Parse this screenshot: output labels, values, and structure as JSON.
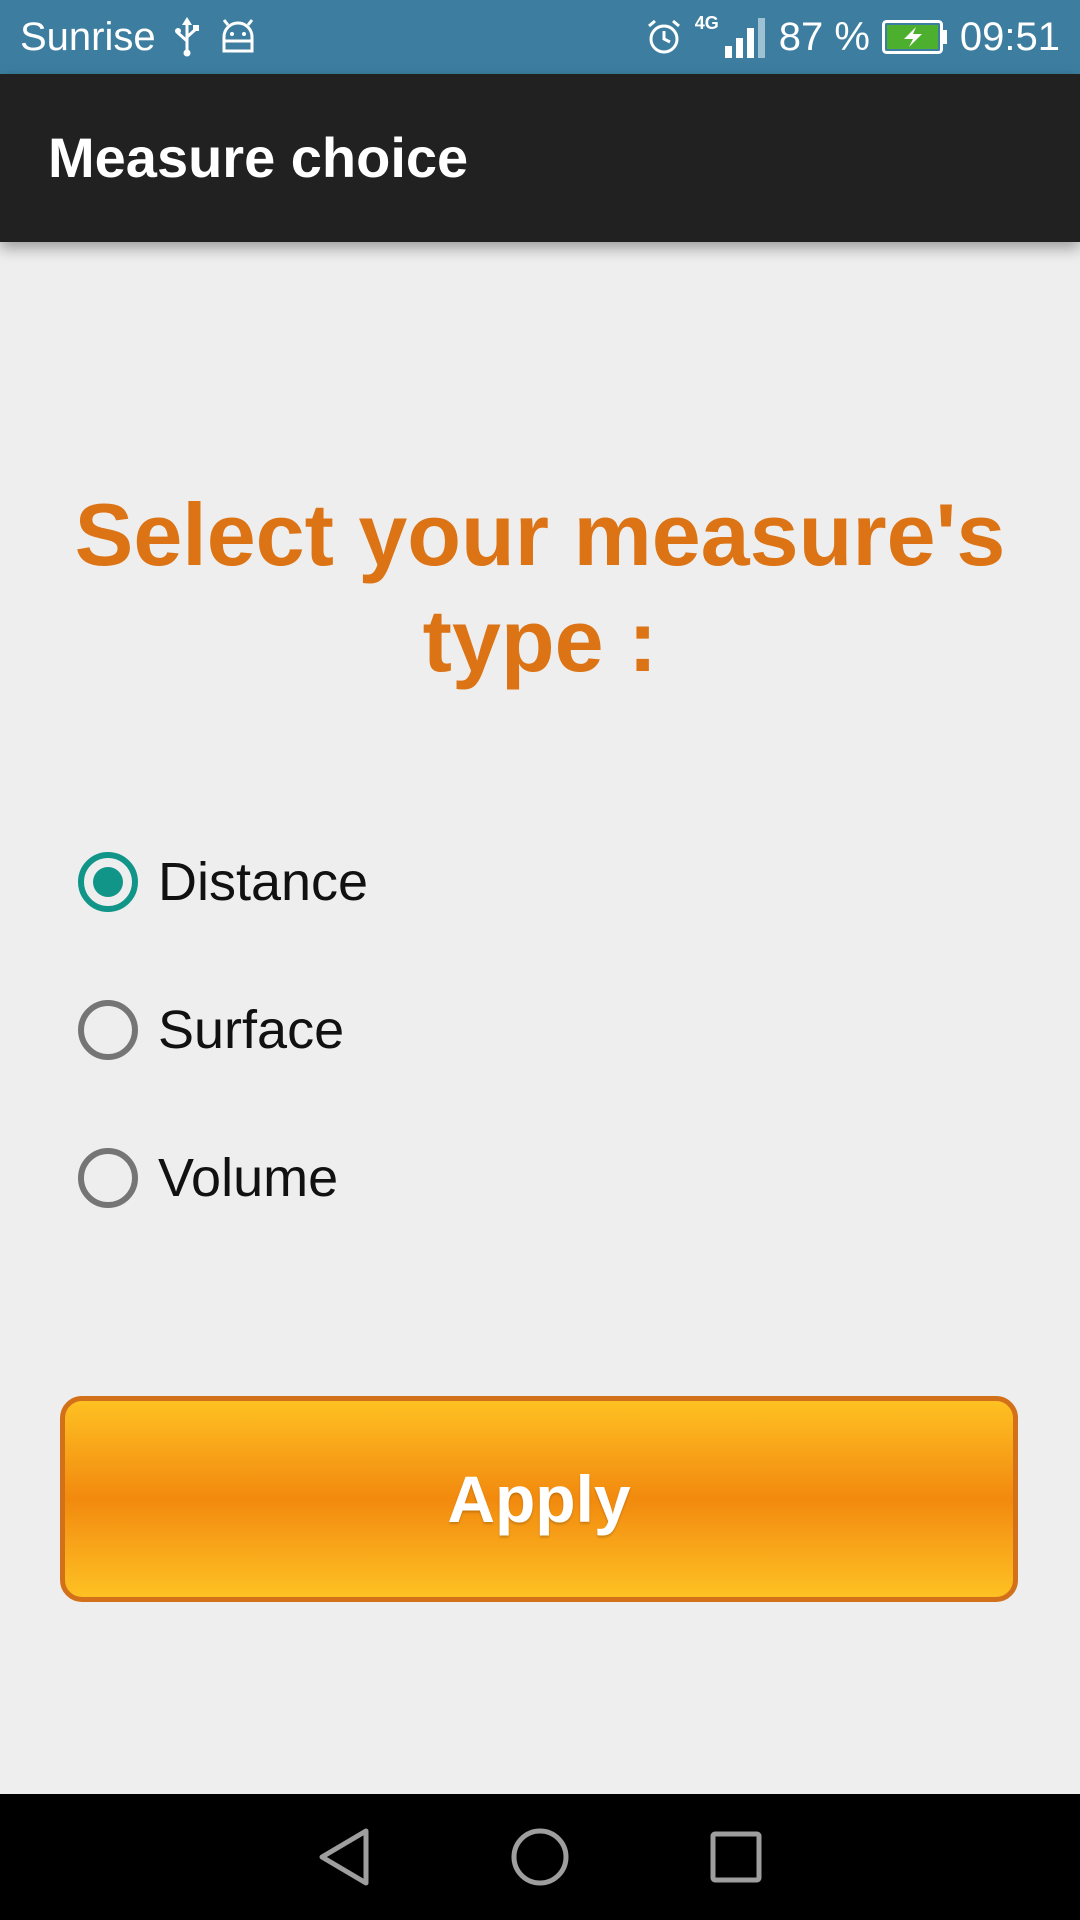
{
  "status_bar": {
    "carrier": "Sunrise",
    "network": "4G",
    "battery": "87 %",
    "time": "09:51",
    "icons": [
      "usb-icon",
      "android-debug-icon",
      "alarm-icon",
      "signal-icon",
      "battery-charging-icon"
    ]
  },
  "app_bar": {
    "title": "Measure choice"
  },
  "main": {
    "heading": "Select your measure's type :",
    "options": [
      {
        "label": "Distance",
        "checked": true
      },
      {
        "label": "Surface",
        "checked": false
      },
      {
        "label": "Volume",
        "checked": false
      }
    ],
    "apply_label": "Apply"
  },
  "nav_bar": {
    "icons": [
      "back-icon",
      "home-icon",
      "recents-icon"
    ]
  },
  "colors": {
    "status_bar": "#3d7ea0",
    "app_bar": "#212121",
    "heading": "#dc7314",
    "radio_accent": "#109588",
    "button_border": "#d3701a",
    "button_fill": "#f28a0e"
  }
}
